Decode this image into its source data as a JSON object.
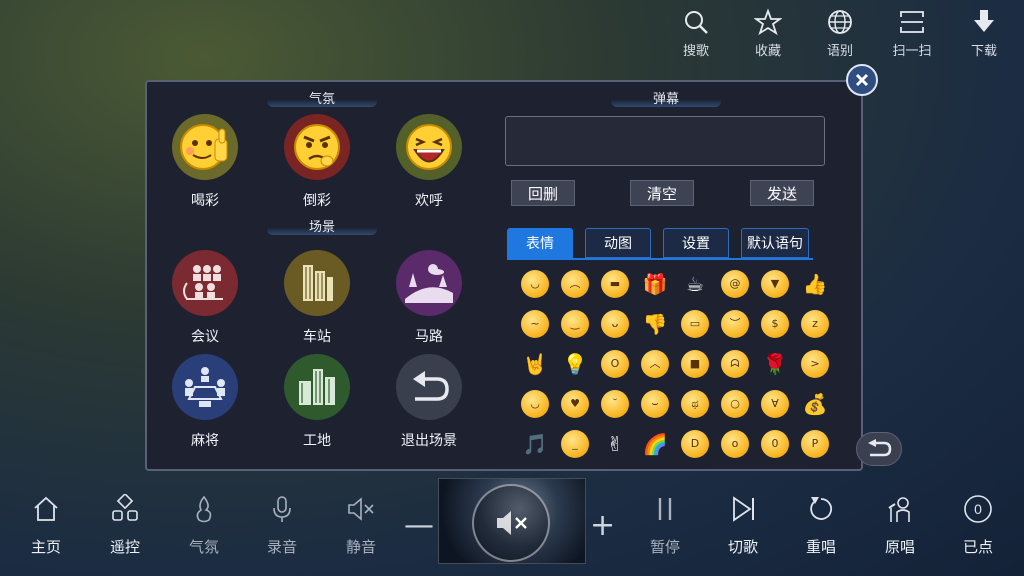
{
  "top_toolbar": [
    {
      "label": "搜歌",
      "icon": "search-icon"
    },
    {
      "label": "收藏",
      "icon": "star-icon"
    },
    {
      "label": "语别",
      "icon": "globe-icon"
    },
    {
      "label": "扫一扫",
      "icon": "scan-icon"
    },
    {
      "label": "下载",
      "icon": "download-icon"
    }
  ],
  "dialog": {
    "atmosphere_title": "气氛",
    "atmosphere": [
      {
        "label": "喝彩",
        "icon": "thumbs-up-face-icon"
      },
      {
        "label": "倒彩",
        "icon": "angry-face-icon"
      },
      {
        "label": "欢呼",
        "icon": "laughing-face-icon"
      }
    ],
    "scene_title": "场景",
    "scenes": [
      {
        "label": "会议",
        "icon": "meeting-icon"
      },
      {
        "label": "车站",
        "icon": "station-buildings-icon"
      },
      {
        "label": "马路",
        "icon": "road-icon"
      },
      {
        "label": "麻将",
        "icon": "mahjong-table-icon"
      },
      {
        "label": "工地",
        "icon": "construction-site-icon"
      },
      {
        "label": "退出场景",
        "icon": "exit-scene-icon"
      }
    ],
    "danmu_title": "弹幕",
    "danmu_input_value": "",
    "danmu_buttons": {
      "backspace": "回删",
      "clear": "清空",
      "send": "发送"
    },
    "tabs": [
      {
        "label": "表情",
        "active": true
      },
      {
        "label": "动图",
        "active": false
      },
      {
        "label": "设置",
        "active": false
      },
      {
        "label": "默认语句",
        "active": false
      }
    ],
    "emoticons": [
      "smile",
      "worried",
      "grimace",
      "gift",
      "coffee",
      "dizzy",
      "rage",
      "thumbs-up",
      "sick",
      "blank",
      "sneaky",
      "thumbs-down",
      "grin",
      "sweat",
      "money",
      "sleepy",
      "rock-hand",
      "lightbulb",
      "shout",
      "frown",
      "sunglasses",
      "angry",
      "rose",
      "squint",
      "happy",
      "heart-eyes",
      "smirk",
      "sly",
      "cry",
      "scared",
      "sob",
      "coins",
      "music-notes",
      "annoyed",
      "peace-hand",
      "rainbow",
      "laugh",
      "surprised",
      "shocked",
      "tongue"
    ]
  },
  "bottom_bar": [
    {
      "label": "主页",
      "icon": "home-icon"
    },
    {
      "label": "遥控",
      "icon": "remote-grid-icon"
    },
    {
      "label": "气氛",
      "icon": "flame-icon"
    },
    {
      "label": "录音",
      "icon": "microphone-icon"
    },
    {
      "label": "静音",
      "icon": "mute-icon"
    },
    {
      "label": "暂停",
      "icon": "pause-icon"
    },
    {
      "label": "切歌",
      "icon": "next-icon"
    },
    {
      "label": "重唱",
      "icon": "replay-icon"
    },
    {
      "label": "原唱",
      "icon": "vocal-icon"
    },
    {
      "label": "已点",
      "icon": "queue-count-icon",
      "count": "0"
    }
  ],
  "volume": {
    "minus": "—",
    "plus": "+"
  }
}
